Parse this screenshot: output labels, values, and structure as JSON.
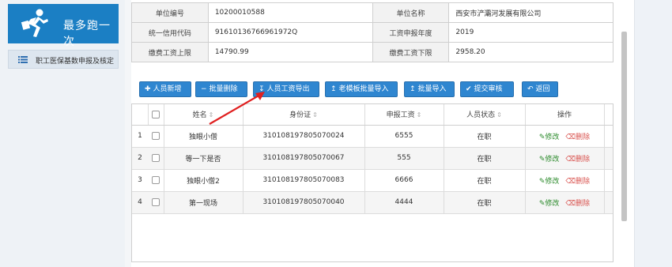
{
  "sidebar": {
    "logo_text": "最多跑一次",
    "menu_item": "职工医保基数申报及核定"
  },
  "info": {
    "rows": [
      {
        "k1": "单位编号",
        "v1": "10200010588",
        "k2": "单位名称",
        "v2": "西安市浐灞河发展有限公司"
      },
      {
        "k1": "统一信用代码",
        "v1": "91610136766961972Q",
        "k2": "工资申报年度",
        "v2": "2019"
      },
      {
        "k1": "缴费工资上限",
        "v1": "14790.99",
        "k2": "缴费工资下限",
        "v2": "2958.20"
      }
    ]
  },
  "toolbar": {
    "add": "人员新增",
    "batch_delete": "批量删除",
    "export": "人员工资导出",
    "template_import": "老模板批量导入",
    "batch_import": "批量导入",
    "submit": "提交审核",
    "back": "返回"
  },
  "grid": {
    "headers": [
      "姓名",
      "身份证",
      "申报工资",
      "人员状态",
      "操作"
    ],
    "rows": [
      {
        "no": "1",
        "name": "独眼小僧",
        "id": "310108197805070024",
        "salary": "6555",
        "status": "在职"
      },
      {
        "no": "2",
        "name": "等一下是否",
        "id": "310108197805070067",
        "salary": "555",
        "status": "在职"
      },
      {
        "no": "3",
        "name": "独眼小僧2",
        "id": "310108197805070083",
        "salary": "6666",
        "status": "在职"
      },
      {
        "no": "4",
        "name": "第一现场",
        "id": "310108197805070040",
        "salary": "4444",
        "status": "在职"
      }
    ],
    "edit_label": "修改",
    "delete_label": "删除"
  },
  "colors": {
    "brand": "#1b7fc4",
    "button": "#2f86d0",
    "annotation_arrow": "#e02020"
  }
}
